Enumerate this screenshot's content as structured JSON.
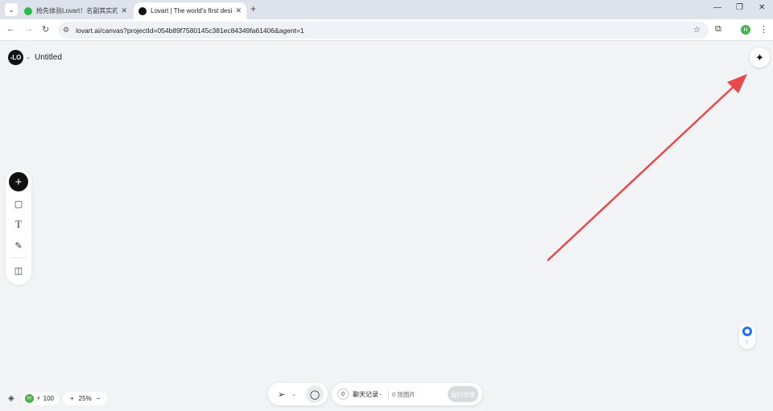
{
  "browser": {
    "tabs": [
      {
        "title": "抢先体验Lovart！名副其实的设",
        "active": false,
        "favicon_color": "#2bbb4f"
      },
      {
        "title": "Lovart | The world's first desi",
        "active": true,
        "favicon_color": "#111111"
      }
    ],
    "new_tab_glyph": "+",
    "url": "lovart.ai/canvas?projectId=054b89f7580145c381ec84349fa61406&agent=1",
    "profile_initial": "H"
  },
  "app": {
    "logo_text": "-LO",
    "project_title": "Untitled",
    "assistant_icon": "sparkle-icon"
  },
  "rail": {
    "tools": [
      "add",
      "rectangle",
      "text",
      "pen",
      "panel"
    ]
  },
  "status": {
    "avatar_initial": "H",
    "credits": "100",
    "zoom": "25%"
  },
  "bottom_bar": {
    "chat_count": "0",
    "history_label": "聊天记录",
    "images_label": "0 张图片",
    "run_all_label": "运行全部"
  },
  "colors": {
    "arrow": "#e8484a",
    "canvas": "#f2f3f5",
    "accent_blue": "#1e6ff5"
  }
}
